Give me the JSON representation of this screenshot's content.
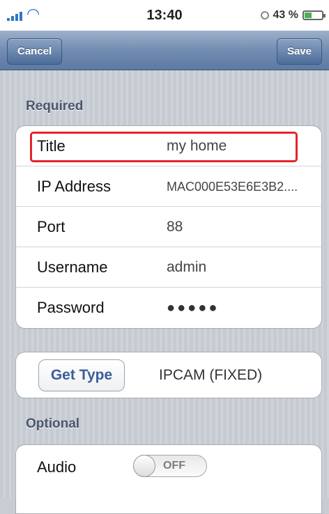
{
  "status_bar": {
    "time": "13:40",
    "battery_percent": "43 %",
    "battery_level": 0.43
  },
  "nav": {
    "cancel_label": "Cancel",
    "save_label": "Save"
  },
  "required": {
    "header": "Required",
    "rows": [
      {
        "label": "Title",
        "value": "my home"
      },
      {
        "label": "IP Address",
        "value": "MAC000E53E6E3B2...."
      },
      {
        "label": "Port",
        "value": "88"
      },
      {
        "label": "Username",
        "value": "admin"
      },
      {
        "label": "Password",
        "value": "●●●●●"
      }
    ]
  },
  "type": {
    "button_label": "Get Type",
    "value": "IPCAM (FIXED)"
  },
  "optional": {
    "header": "Optional",
    "audio_label": "Audio",
    "audio_state": "OFF"
  },
  "colors": {
    "highlight": "#e2252b",
    "nav_blue": "#6f8ab0",
    "button_text": "#3c5d98"
  }
}
